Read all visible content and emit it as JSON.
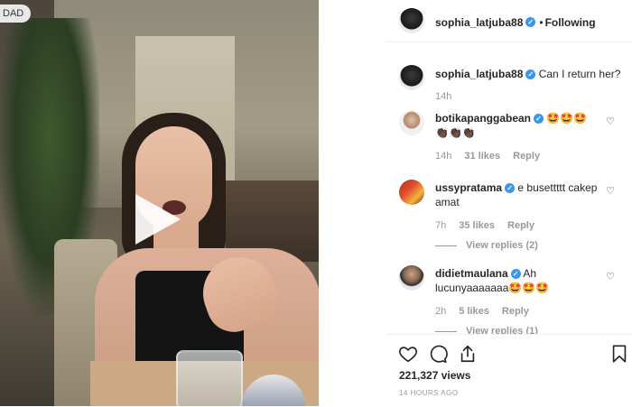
{
  "video": {
    "badge": "DAD"
  },
  "header": {
    "username": "sophia_latjuba88",
    "verified": "✓",
    "separator": "•",
    "follow_label": "Following"
  },
  "caption": {
    "username": "sophia_latjuba88",
    "text": "Can I return her?",
    "time": "14h"
  },
  "comments": [
    {
      "username": "botikapanggabean",
      "text": "🤩🤩🤩",
      "text2": "👏🏿👏🏿👏🏿",
      "time": "14h",
      "likes": "31 likes",
      "reply": "Reply"
    },
    {
      "username": "ussypratama",
      "text": "e busettttt cakep",
      "text2": "amat",
      "time": "7h",
      "likes": "35 likes",
      "reply": "Reply",
      "view_replies": "View replies (2)"
    },
    {
      "username": "didietmaulana",
      "text": "Ah",
      "text2": "lucunyaaaaaaa🤩🤩🤩",
      "time": "2h",
      "likes": "5 likes",
      "reply": "Reply",
      "view_replies": "View replies (1)"
    }
  ],
  "actions": {
    "views": "221,327 views",
    "timestamp": "14 HOURS AGO",
    "icons": [
      "heart-icon",
      "comment-icon",
      "share-icon",
      "bookmark-icon"
    ]
  },
  "colors": {
    "verified": "#3897f0",
    "meta": "#999999",
    "text": "#262626"
  }
}
